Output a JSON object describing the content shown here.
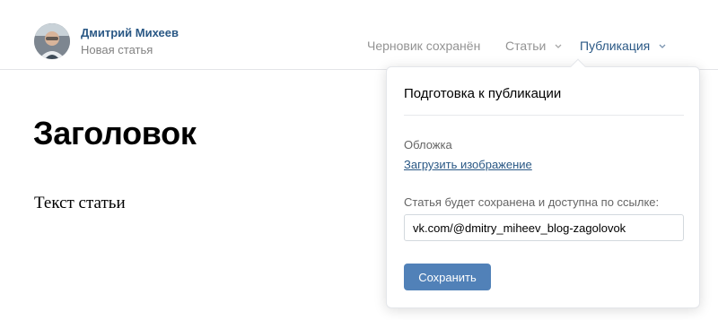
{
  "header": {
    "author_name": "Дмитрий Михеев",
    "author_subtitle": "Новая статья",
    "avatar_icon": "user-avatar",
    "nav": {
      "draft_status": "Черновик сохранён",
      "articles_label": "Статьи",
      "publish_label": "Публикация"
    }
  },
  "editor": {
    "title": "Заголовок",
    "body_text": "Текст статьи"
  },
  "publish_popup": {
    "title": "Подготовка к публикации",
    "cover_label": "Обложка",
    "upload_link": "Загрузить изображение",
    "url_label": "Статья будет сохранена и доступна по ссылке:",
    "url_value": "vk.com/@dmitry_miheev_blog-zagolovok",
    "save_button": "Сохранить"
  },
  "colors": {
    "link_blue": "#2a5885",
    "button_blue": "#5181b8",
    "muted_gray": "#939393",
    "divider": "#e3e4e8"
  }
}
